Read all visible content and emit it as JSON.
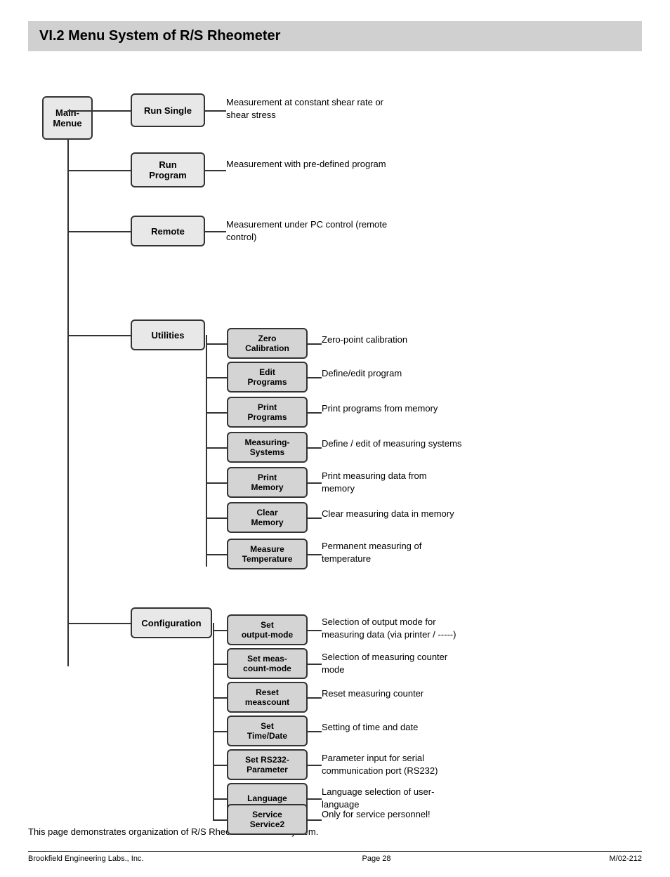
{
  "header": {
    "title": "VI.2  Menu System of R/S Rheometer"
  },
  "nodes": {
    "main": {
      "label": "Main-\nMenue"
    },
    "run_single": {
      "label": "Run Single"
    },
    "run_program": {
      "label": "Run\nProgram"
    },
    "remote": {
      "label": "Remote"
    },
    "utilities": {
      "label": "Utilities"
    },
    "configuration": {
      "label": "Configuration"
    },
    "zero_cal": {
      "label": "Zero\nCalibration"
    },
    "edit_programs": {
      "label": "Edit\nPrograms"
    },
    "print_programs": {
      "label": "Print\nPrograms"
    },
    "measuring_systems": {
      "label": "Measuring-\nSystems"
    },
    "print_memory": {
      "label": "Print\nMemory"
    },
    "clear_memory": {
      "label": "Clear\nMemory"
    },
    "measure_temp": {
      "label": "Measure\nTemperature"
    },
    "set_output": {
      "label": "Set\noutput-mode"
    },
    "set_meas": {
      "label": "Set meas-\ncount-mode"
    },
    "reset_meas": {
      "label": "Reset\nmeascount"
    },
    "set_time": {
      "label": "Set\nTime/Date"
    },
    "set_rs232": {
      "label": "Set RS232-\nParameter"
    },
    "language": {
      "label": "Language"
    },
    "service": {
      "label": "Service\nService2"
    }
  },
  "descriptions": {
    "run_single": "Measurement at constant shear rate or shear stress",
    "run_program": "Measurement with pre-defined program",
    "remote": "Measurement under PC control (remote control)",
    "zero_cal": "Zero-point calibration",
    "edit_programs": "Define/edit program",
    "print_programs": "Print programs from memory",
    "measuring_systems": "Define / edit of measuring systems",
    "print_memory": "Print measuring data from memory",
    "clear_memory": "Clear measuring data in memory",
    "measure_temp": "Permanent measuring of temperature",
    "set_output": "Selection of output mode for measuring data (via printer / -----)",
    "set_meas": "Selection of measuring counter mode",
    "reset_meas": "Reset measuring counter",
    "set_time": "Setting of time and date",
    "set_rs232": "Parameter input for serial communication port (RS232)",
    "language": "Language selection of user-language",
    "service": "Only for service personnel!"
  },
  "footer": {
    "left": "Brookfield Engineering Labs., Inc.",
    "center": "Page 28",
    "right": "M/02-212",
    "caption": "This page demonstrates organization of R/S Rheometer menue system."
  }
}
